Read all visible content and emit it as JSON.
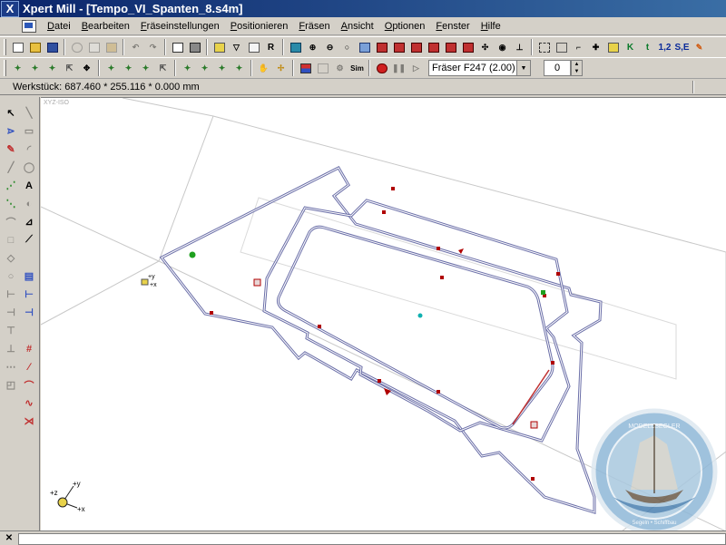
{
  "window": {
    "title": "Xpert Mill - [Tempo_VI_Spanten_8.s4m]",
    "app_icon": "X"
  },
  "menu": [
    "Datei",
    "Bearbeiten",
    "Fräseinstellungen",
    "Positionieren",
    "Fräsen",
    "Ansicht",
    "Optionen",
    "Fenster",
    "Hilfe"
  ],
  "toolbar1": {
    "icons": [
      "new-icon",
      "open-icon",
      "save-icon",
      "cut-icon",
      "copy-icon",
      "paste-icon",
      "undo-icon",
      "redo-icon",
      "print-preview-icon",
      "print-icon",
      "workpiece-icon",
      "filter-icon",
      "import-icon",
      "reset-icon",
      "view-icon",
      "zoom-in-icon",
      "zoom-out-icon",
      "zoom-icon",
      "view-iso-icon",
      "view-front-icon",
      "view-back-icon",
      "view-left-icon",
      "view-right-icon",
      "view-top-icon",
      "view-bottom-icon",
      "rotate-icon",
      "eye-icon",
      "axis-icon",
      "grid-icon",
      "frame-icon",
      "snap-icon",
      "crosshair-icon",
      "tool-icon"
    ],
    "text_buttons": {
      "reset": "R",
      "k": "K",
      "t": "t",
      "num": "1,2",
      "se": "S,E"
    }
  },
  "toolbar2": {
    "icons": [
      "mill-1-icon",
      "mill-2-icon",
      "mill-3-icon",
      "mill-4-icon",
      "center-icon",
      "mill-5-icon",
      "mill-6-icon",
      "mill-7-icon",
      "mill-8-icon",
      "mill-9-icon",
      "mill-10-icon",
      "mill-11-icon",
      "mill-12-icon",
      "hand-icon",
      "move-icon",
      "layers-icon",
      "select-icon",
      "settings-icon",
      "stop-icon",
      "pause-icon",
      "play-icon"
    ],
    "sim_label": "Sim",
    "tool_select": "Fräser F247 (2.00)",
    "quantity": "0"
  },
  "status": {
    "workpiece": "Werkstück: 687.460 * 255.116 * 0.000 mm"
  },
  "viewport": {
    "label": "XYZ-ISO",
    "axis_x": "+x",
    "axis_y": "+y",
    "axis_z": "+z"
  },
  "watermark": {
    "text_top": "MODELLSEGLER",
    "text_bottom": "Segeln • Schiffbau"
  },
  "colors": {
    "title_start": "#0a246a",
    "title_end": "#3a6ea5",
    "path": "#6b6fa8",
    "marker_red": "#b00000",
    "marker_green": "#1ea01e",
    "marker_cyan": "#10b0b0"
  }
}
